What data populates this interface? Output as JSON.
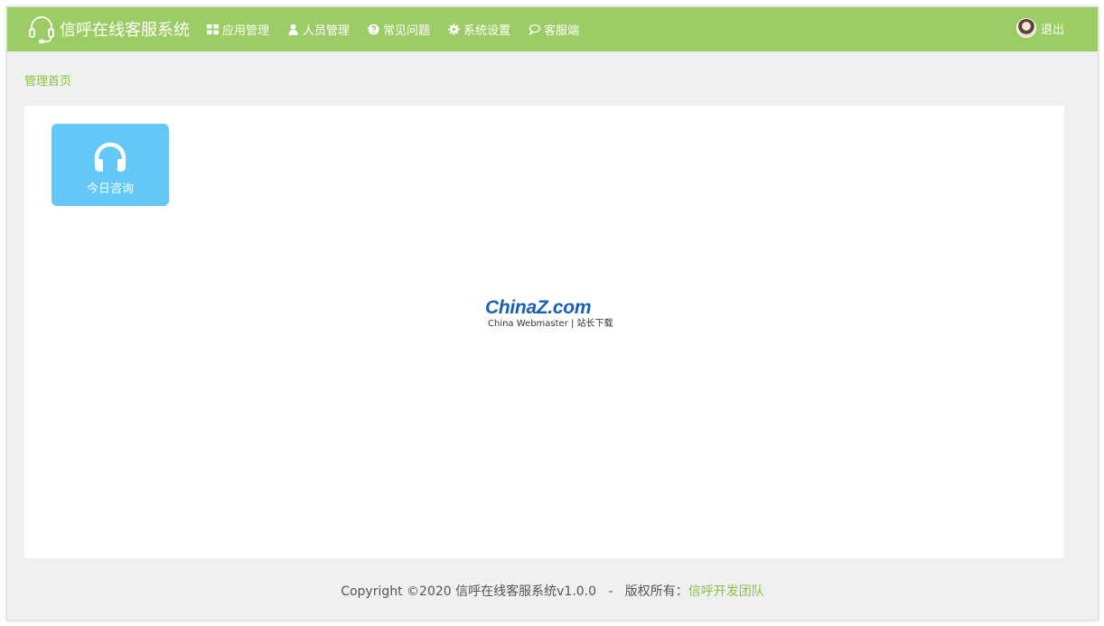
{
  "header": {
    "title": "信呼在线客服系统",
    "nav": [
      {
        "label": "应用管理",
        "icon": "grid-icon"
      },
      {
        "label": "人员管理",
        "icon": "user-icon"
      },
      {
        "label": "常见问题",
        "icon": "question-circle-icon"
      },
      {
        "label": "系统设置",
        "icon": "gear-icon"
      },
      {
        "label": "客服端",
        "icon": "chat-bubble-icon"
      }
    ],
    "logout_label": "退出"
  },
  "breadcrumb": "管理首页",
  "tiles": [
    {
      "label": "今日咨询",
      "icon": "headphones-icon"
    }
  ],
  "watermark": {
    "logo_china": "China",
    "logo_z": "Z",
    "logo_com": ".com",
    "subtitle": "China Webmaster | 站长下载"
  },
  "footer": {
    "copyright": "Copyright ©2020 信呼在线客服系统v1.0.0   -   版权所有：",
    "link": "信呼开发团队"
  },
  "colors": {
    "header_bg": "#9ccc65",
    "accent": "#8bc34a",
    "tile_bg": "#64c8f6",
    "page_bg": "#f0f0f0"
  }
}
